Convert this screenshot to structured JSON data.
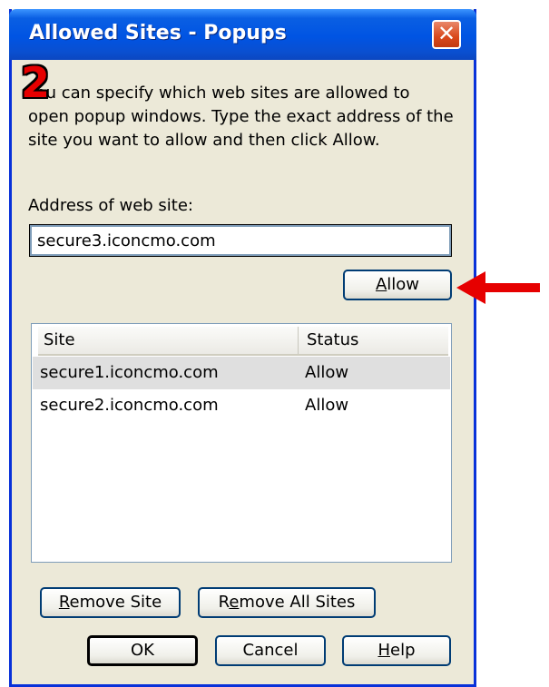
{
  "window": {
    "title": "Allowed Sites - Popups",
    "close_glyph": "✕"
  },
  "annotation": {
    "step_number": "2",
    "arrow_color": "#e60000"
  },
  "description": "You can specify which web sites are allowed to open popup windows. Type the exact address of the site you want to allow and then click Allow.",
  "address": {
    "label": "Address of web site:",
    "value": "secure3.iconcmo.com"
  },
  "buttons": {
    "allow_pre": "",
    "allow_mn": "A",
    "allow_post": "llow",
    "remove_site_pre": "",
    "remove_site_mn": "R",
    "remove_site_post": "emove Site",
    "remove_all_pre": "R",
    "remove_all_mn": "e",
    "remove_all_post": "move All Sites",
    "ok": "OK",
    "cancel": "Cancel",
    "help_pre": "",
    "help_mn": "H",
    "help_post": "elp"
  },
  "site_list": {
    "columns": [
      "Site",
      "Status"
    ],
    "rows": [
      {
        "site": "secure1.iconcmo.com",
        "status": "Allow",
        "selected": true
      },
      {
        "site": "secure2.iconcmo.com",
        "status": "Allow",
        "selected": false
      }
    ]
  },
  "colors": {
    "titlebar": "#0054e3",
    "dialog_bg": "#ece9d8",
    "close_button": "#d9481c"
  }
}
